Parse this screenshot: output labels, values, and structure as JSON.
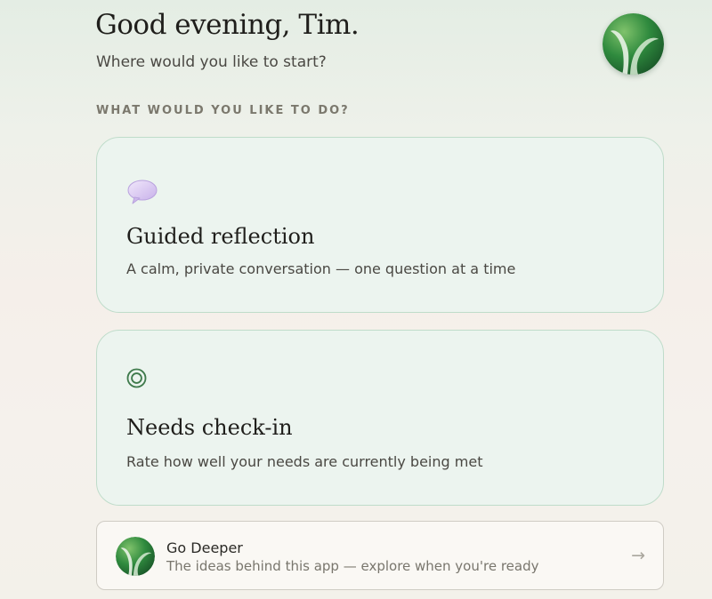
{
  "header": {
    "greeting": "Good evening, Tim.",
    "subtitle": "Where would you like to start?"
  },
  "section": {
    "label": "WHAT WOULD YOU LIKE TO DO?"
  },
  "cards": [
    {
      "icon": "speech-bubble-icon",
      "title": "Guided reflection",
      "description": "A calm, private conversation — one question at a time"
    },
    {
      "icon": "target-icon",
      "title": "Needs check-in",
      "description": "Rate how well your needs are currently being met"
    }
  ],
  "go_deeper": {
    "icon": "app-logo-icon",
    "title": "Go Deeper",
    "description": "The ideas behind this app — explore when you're ready",
    "arrow": "→"
  },
  "colors": {
    "card_background": "#ecf4ef",
    "card_border": "#bfdcca",
    "logo_green": "#2f7d3f",
    "bubble_lilac": "#d9c6f0",
    "target_green": "#3f7a4c"
  }
}
